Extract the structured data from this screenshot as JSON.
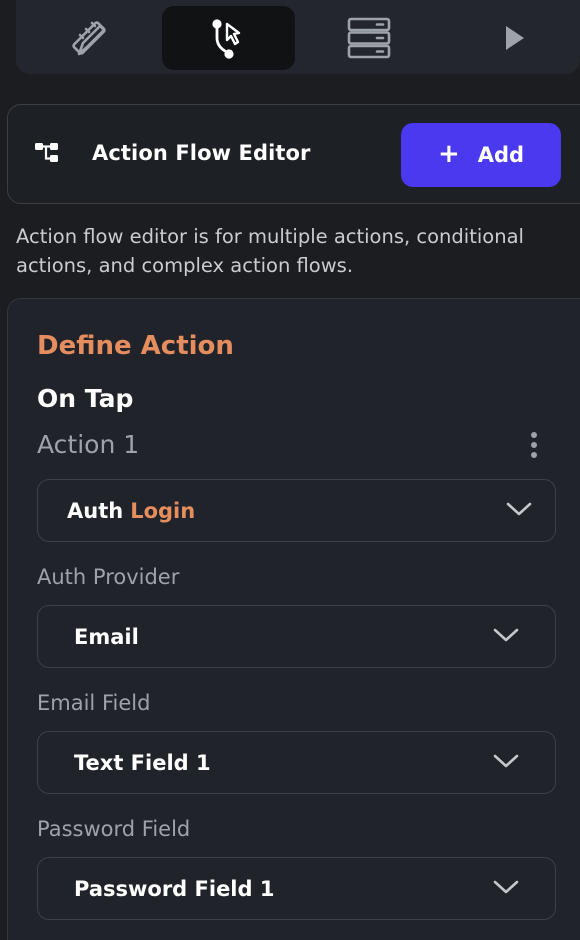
{
  "tabs": [
    {
      "id": "design",
      "icon": "pencil-ruler-icon",
      "active": false
    },
    {
      "id": "actions",
      "icon": "action-flow-cursor-icon",
      "active": true
    },
    {
      "id": "backend",
      "icon": "database-server-icon",
      "active": false
    },
    {
      "id": "run",
      "icon": "play-icon",
      "active": false
    }
  ],
  "flow_editor": {
    "icon": "flow-tree-icon",
    "title": "Action Flow Editor",
    "add_label": "Add",
    "add_icon": "plus-icon",
    "description": "Action flow editor is for multiple actions, conditional actions, and complex action flows."
  },
  "define_action": {
    "title": "Define Action",
    "trigger": "On Tap",
    "action_name": "Action 1",
    "action_type": {
      "category": "Auth",
      "name": "Login"
    },
    "fields": [
      {
        "label": "Auth Provider",
        "value": "Email"
      },
      {
        "label": "Email Field",
        "value": "Text Field 1"
      },
      {
        "label": "Password Field",
        "value": "Password Field 1"
      }
    ]
  },
  "colors": {
    "accent_orange": "#e58d5e",
    "primary_button": "#4b39ef",
    "background": "#1b1d21"
  }
}
